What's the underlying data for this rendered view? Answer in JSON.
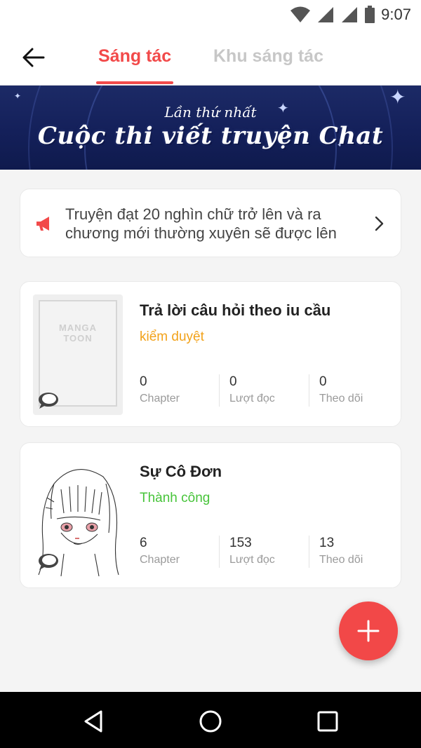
{
  "status_bar": {
    "time": "9:07",
    "icons": [
      "wifi-icon",
      "signal-icon",
      "signal-icon",
      "battery-icon"
    ]
  },
  "header": {
    "back_icon": "arrow-left-icon",
    "tabs": [
      {
        "label": "Sáng tác",
        "active": true
      },
      {
        "label": "Khu sáng tác",
        "active": false
      }
    ]
  },
  "banner": {
    "subtitle": "Lần thứ nhất",
    "title": "Cuộc thi viết truyện Chat"
  },
  "notice": {
    "icon": "megaphone-icon",
    "text": "Truyện đạt 20 nghìn chữ trở lên và ra chương mới thường xuyên sẽ được lên",
    "chevron": "chevron-right-icon"
  },
  "works": [
    {
      "title": "Trả lời câu hỏi theo iu cầu",
      "status": "kiểm duyệt",
      "cover_placeholder": {
        "line1": "MANGA",
        "line2": "TOON"
      },
      "stats": [
        {
          "value": "0",
          "label": "Chapter"
        },
        {
          "value": "0",
          "label": "Lượt đọc"
        },
        {
          "value": "0",
          "label": "Theo dõi"
        }
      ]
    },
    {
      "title": "Sự Cô Đơn",
      "status": "Thành công",
      "stats": [
        {
          "value": "6",
          "label": "Chapter"
        },
        {
          "value": "153",
          "label": "Lượt đọc"
        },
        {
          "value": "13",
          "label": "Theo dõi"
        }
      ]
    }
  ],
  "fab": {
    "icon": "plus-icon"
  },
  "colors": {
    "accent": "#f24a4a",
    "review": "#f2a21a",
    "success": "#47c43a",
    "tab_inactive": "#c7c7c7"
  },
  "nav_bar": {
    "buttons": [
      "back-triangle-icon",
      "home-circle-icon",
      "recents-square-icon"
    ]
  }
}
